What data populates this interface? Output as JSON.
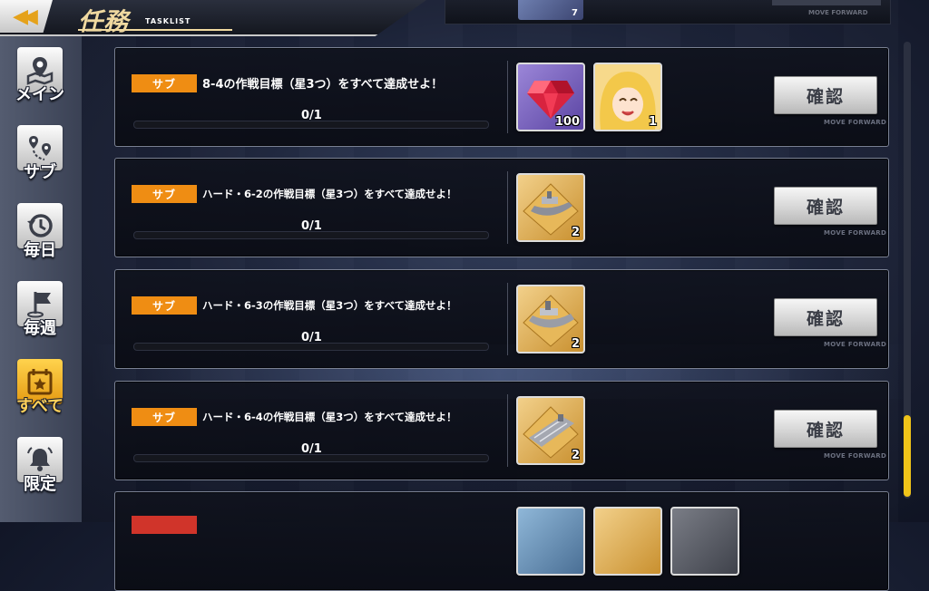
{
  "header": {
    "back_icon": "double-chevron-left-icon",
    "title": "任務",
    "subtitle": "TASKLIST"
  },
  "top_partial": {
    "reward_count": "7",
    "move_forward": "MOVE FORWARD"
  },
  "sidebar": {
    "items": [
      {
        "label": "メイン",
        "icon": "map-pin-icon",
        "active": false
      },
      {
        "label": "サブ",
        "icon": "route-pins-icon",
        "active": false
      },
      {
        "label": "毎日",
        "icon": "history-clock-icon",
        "active": false
      },
      {
        "label": "毎週",
        "icon": "flag-icon",
        "active": false
      },
      {
        "label": "すべて",
        "icon": "calendar-star-icon",
        "active": true
      },
      {
        "label": "限定",
        "icon": "bell-icon",
        "active": false
      }
    ]
  },
  "tasks": [
    {
      "badge": "サブ",
      "text": "8-4の作戦目標（星3つ）をすべて達成せよ！",
      "progress": "0/1",
      "progress_fraction": 0,
      "rewards": [
        {
          "icon": "ruby-gem-icon",
          "count": "100"
        },
        {
          "icon": "blonde-character-portrait-icon",
          "count": "1"
        }
      ],
      "button": "確認",
      "button_sub": "MOVE FORWARD"
    },
    {
      "badge": "サブ",
      "text": "ハード・6-2の作戦目標（星3つ）をすべて達成せよ！",
      "progress": "0/1",
      "progress_fraction": 0,
      "rewards": [
        {
          "icon": "warship-blueprint-icon",
          "count": "2"
        }
      ],
      "button": "確認",
      "button_sub": "MOVE FORWARD"
    },
    {
      "badge": "サブ",
      "text": "ハード・6-3の作戦目標（星3つ）をすべて達成せよ！",
      "progress": "0/1",
      "progress_fraction": 0,
      "rewards": [
        {
          "icon": "warship-blueprint-icon",
          "count": "2"
        }
      ],
      "button": "確認",
      "button_sub": "MOVE FORWARD"
    },
    {
      "badge": "サブ",
      "text": "ハード・6-4の作戦目標（星3つ）をすべて達成せよ！",
      "progress": "0/1",
      "progress_fraction": 0,
      "rewards": [
        {
          "icon": "carrier-blueprint-icon",
          "count": "2"
        }
      ],
      "button": "確認",
      "button_sub": "MOVE FORWARD"
    }
  ],
  "colors": {
    "badge_sub": "#ef8d13",
    "active_tab": "#ffd34d",
    "scroll_thumb": "#f0c419"
  }
}
